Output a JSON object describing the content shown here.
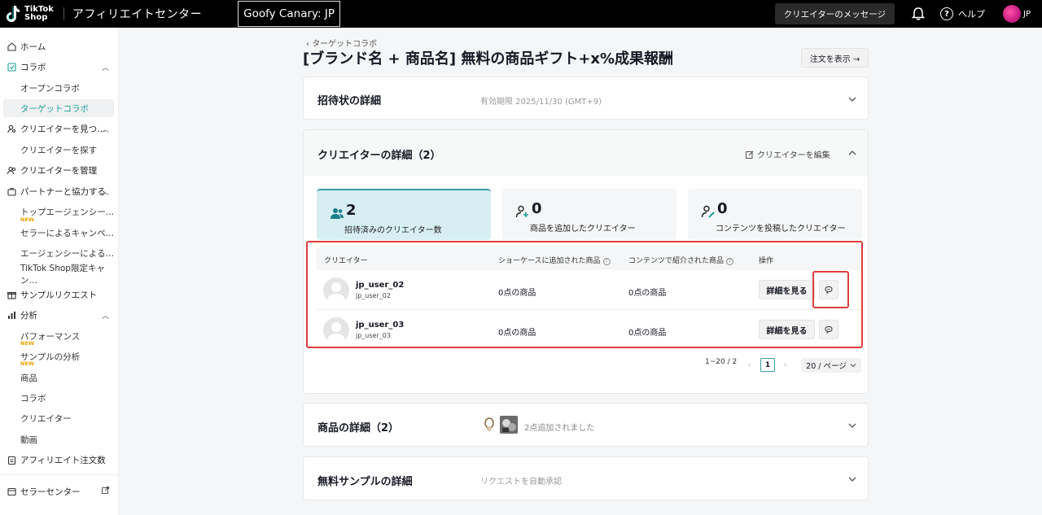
{
  "topbar": {
    "logo_line1": "TikTok",
    "logo_line2": "Shop",
    "app_title": "アフィリエイトセンター",
    "shop_name": "Goofy Canary: JP",
    "messages_label": "クリエイターのメッセージ",
    "help_label": "ヘルプ",
    "region_label": "JP"
  },
  "sidebar": {
    "home": "ホーム",
    "collab": "コラボ",
    "open_collab": "オープンコラボ",
    "target_collab": "ターゲットコラボ",
    "find_creators": "クリエイターを見つ…",
    "search_creators": "クリエイターを探す",
    "manage_creators": "クリエイターを管理",
    "partner": "パートナーと協力する",
    "top_agency": "トップエージェンシー…",
    "seller_campaign": "セラーによるキャンペ…",
    "agency_campaign": "エージェンシーによる…",
    "tiktok_campaign": "TikTok Shop限定キャン…",
    "sample_requests": "サンプルリクエスト",
    "analytics": "分析",
    "performance": "パフォーマンス",
    "sample_analysis": "サンプルの分析",
    "products": "商品",
    "collabs": "コラボ",
    "creators": "クリエイター",
    "videos": "動画",
    "affiliate_orders": "アフィリエイト注文数",
    "seller_center": "セラーセンター",
    "new_badge": "NEW"
  },
  "header": {
    "back_label": "ターゲットコラボ",
    "title": "[ブランド名 + 商品名] 無料の商品ギフト+x%成果報酬",
    "orders_button": "注文を表示 →"
  },
  "invitation": {
    "title": "招待状の詳細",
    "validity": "有効期限 2025/11/30 (GMT+9)"
  },
  "creator_details": {
    "title": "クリエイターの詳細（2）",
    "edit_label": "クリエイターを編集",
    "stats": [
      {
        "value": "2",
        "label": "招待済みのクリエイター数"
      },
      {
        "value": "0",
        "label": "商品を追加したクリエイター"
      },
      {
        "value": "0",
        "label": "コンテンツを投稿したクリエイター"
      }
    ],
    "table": {
      "headers": {
        "creator": "クリエイター",
        "showcase": "ショーケースに追加された商品",
        "content": "コンテンツで紹介された商品",
        "actions": "操作"
      },
      "rows": [
        {
          "name": "jp_user_02",
          "handle": "jp_user_02",
          "showcase": "0点の商品",
          "content": "0点の商品",
          "detail_button": "詳細を見る"
        },
        {
          "name": "jp_user_03",
          "handle": "jp_user_03",
          "showcase": "0点の商品",
          "content": "0点の商品",
          "detail_button": "詳細を見る"
        }
      ]
    },
    "pagination": {
      "range": "1~20 / 2",
      "current_page": "1",
      "per_page": "20 / ページ"
    }
  },
  "product_details": {
    "title": "商品の詳細（2）",
    "added_label": "2点追加されました"
  },
  "sample_details": {
    "title": "無料サンプルの詳細",
    "auto_approve": "リクエストを自動承認"
  },
  "colors": {
    "accent": "#1a9e96",
    "highlight": "#e03c3c",
    "stat_active_bg": "#d7eff2"
  }
}
